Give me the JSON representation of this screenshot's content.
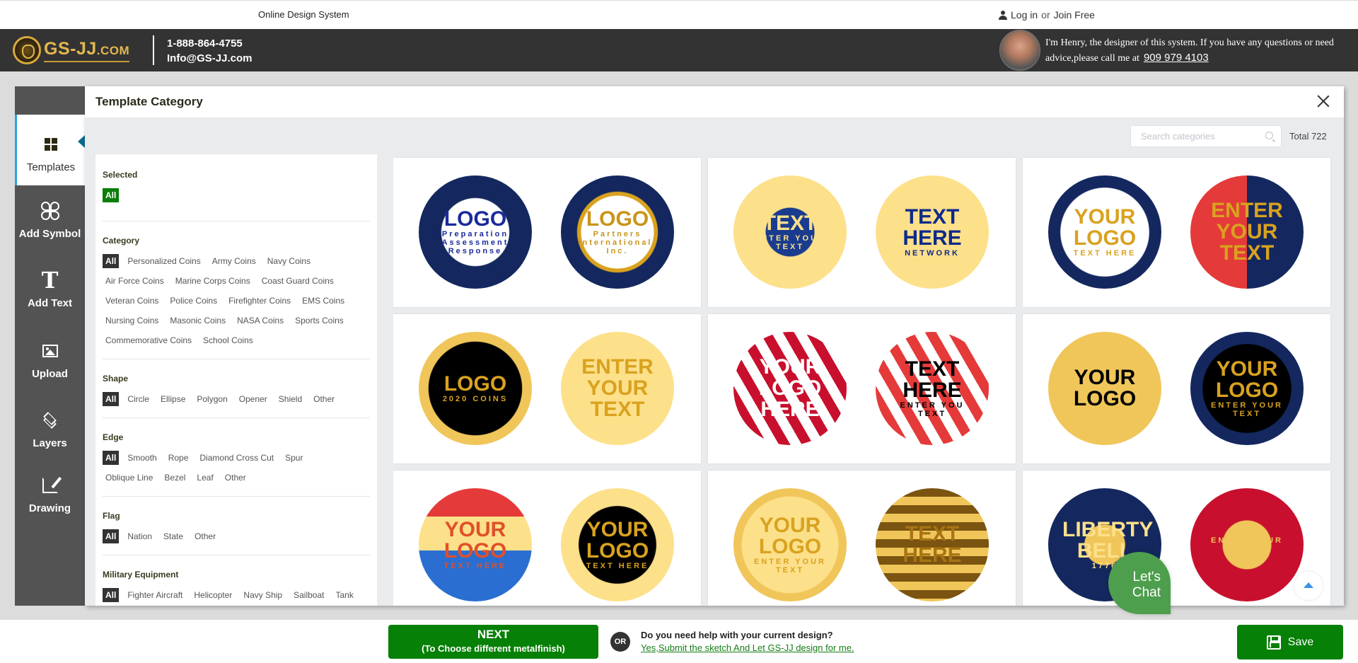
{
  "topbar": {
    "title": "Online Design System",
    "login": "Log in",
    "or": "or",
    "join": "Join Free"
  },
  "header": {
    "logo_text": "GS-JJ",
    "logo_suffix": ".COM",
    "phone": "1-888-864-4755",
    "email": "Info@GS-JJ.com",
    "designer_message": "I'm Henry, the designer of this system. If you have any questions or need advice,please call me at",
    "designer_phone": "909 979 4103"
  },
  "rail": {
    "items": [
      {
        "label": "Templates",
        "icon": "grid-icon",
        "active": true
      },
      {
        "label": "Add Symbol",
        "icon": "symbol-icon"
      },
      {
        "label": "Add Text",
        "icon": "text-icon"
      },
      {
        "label": "Upload",
        "icon": "image-icon"
      },
      {
        "label": "Layers",
        "icon": "layers-icon"
      },
      {
        "label": "Drawing",
        "icon": "edit-icon"
      }
    ],
    "text_glyph": "T"
  },
  "panel": {
    "title": "Template Category",
    "search_placeholder": "Search categories",
    "total": "Total 722"
  },
  "filters": {
    "selected": {
      "title": "Selected",
      "tags": [
        "All"
      ]
    },
    "groups": [
      {
        "title": "Category",
        "tags": [
          "All",
          "Personalized Coins",
          "Army Coins",
          "Navy Coins",
          "Air Force Coins",
          "Marine Corps Coins",
          "Coast Guard Coins",
          "Veteran Coins",
          "Police Coins",
          "Firefighter Coins",
          "EMS Coins",
          "Nursing Coins",
          "Masonic Coins",
          "NASA Coins",
          "Sports Coins",
          "Commemorative Coins",
          "School Coins"
        ]
      },
      {
        "title": "Shape",
        "tags": [
          "All",
          "Circle",
          "Ellipse",
          "Polygon",
          "Opener",
          "Shield",
          "Other"
        ]
      },
      {
        "title": "Edge",
        "tags": [
          "All",
          "Smooth",
          "Rope",
          "Diamond Cross Cut",
          "Spur",
          "Oblique Line",
          "Bezel",
          "Leaf",
          "Other"
        ]
      },
      {
        "title": "Flag",
        "tags": [
          "All",
          "Nation",
          "State",
          "Other"
        ]
      },
      {
        "title": "Military Equipment",
        "tags": [
          "All",
          "Fighter Aircraft",
          "Helicopter",
          "Navy Ship",
          "Sailboat",
          "Tank"
        ]
      }
    ]
  },
  "templates": [
    {
      "front": {
        "text": "LOGO",
        "sub": "Preparation Assessment Response"
      },
      "back": {
        "text": "LOGO",
        "sub": "Partners International, Inc."
      }
    },
    {
      "front": {
        "text": "TEXT",
        "sub": "ENTER YOUR TEXT"
      },
      "back": {
        "text": "TEXT HERE",
        "sub": "NETWORK"
      }
    },
    {
      "front": {
        "text": "YOUR LOGO",
        "sub": "TEXT HERE"
      },
      "back": {
        "text": "ENTER YOUR TEXT",
        "sub": ""
      }
    },
    {
      "front": {
        "text": "LOGO",
        "sub": "2020 COINS"
      },
      "back": {
        "text": "ENTER YOUR TEXT",
        "sub": ""
      }
    },
    {
      "front": {
        "text": "YOUR LOGO HERE",
        "sub": ""
      },
      "back": {
        "text": "TEXT HERE",
        "sub": "ENTER YOU TEXT"
      }
    },
    {
      "front": {
        "text": "YOUR LOGO",
        "sub": ""
      },
      "back": {
        "text": "YOUR LOGO",
        "sub": "ENTER YOUR TEXT"
      }
    },
    {
      "front": {
        "text": "YOUR LOGO",
        "sub": "TEXT HERE"
      },
      "back": {
        "text": "YOUR LOGO",
        "sub": "TEXT HERE"
      }
    },
    {
      "front": {
        "text": "YOUR LOGO",
        "sub": "ENTER YOUR TEXT"
      },
      "back": {
        "text": "TEXT HERE",
        "sub": ""
      }
    },
    {
      "front": {
        "text": "LIBERTY BELL",
        "sub": "1776"
      },
      "back": {
        "text": "",
        "sub": "ENTER YOUR TEXT"
      }
    }
  ],
  "chat": {
    "line1": "Let's",
    "line2": "Chat"
  },
  "bottom": {
    "next_title": "NEXT",
    "next_sub": "(To Choose different metalfinish)",
    "or": "OR",
    "help_question": "Do you need help with your current design?",
    "help_link": "Yes,Submit the sketch And Let GS-JJ design for me.",
    "save": "Save"
  },
  "colors": {
    "brand_green": "#068006",
    "header_dark": "#333333",
    "rail_gray": "#535353",
    "active_accent": "#29a3e0",
    "coin_gold": "#d9a21f",
    "coin_navy": "#14285f"
  }
}
